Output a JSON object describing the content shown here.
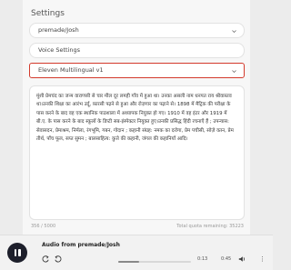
{
  "settings": {
    "title": "Settings"
  },
  "selects": {
    "voice": "premade/Josh",
    "voice_settings": "Voice Settings",
    "model": "Eleven Multilingual v1"
  },
  "editor": {
    "text": "मुंशी प्रेमचंद का जन्म वाराणसी से चार मील दूर लमही गाँव में हुआ था। उनका असली नाम धनपत राय श्रीवास्तव था।उनकी शिक्षा का आरंभ उर्दू, फ़ारसी पढ़ने से हुआ और रोज़गार का पढ़ाने से। 1898 में मैट्रिक की परीक्षा के पास करने के बाद वह एक स्थानिक पाठशाला में अध्यापक नियुक्त हो गए। 1910 में वह इंटर और 1919 में बी.ए. के पास करने के बाद स्कूलों के डिप्टी सब-इंस्पेक्टर नियुक्त हुए।उनकी प्रसिद्ध हिंदी रचनाएँ हैं ; उपन्यास: सेवासदन, प्रेमाश्रम, निर्मला, रंगभूमि, गबन, गोदान ; कहानी संग्रह: नमक का दरोगा, प्रेम पचीसी, सोज़े वतन, प्रेम तीर्थ, पाँच फूल, सप्त सुमन ; बालसाहित्य: कुत्ते की कहानी, जंगल की कहानियाँ आदि।",
    "char_count": "356 / 5000",
    "quota": "Total quota remaining: 35223"
  },
  "player": {
    "title": "Audio from premade/Josh",
    "current_time": "0:13",
    "total_time": "0:45",
    "progress": 0.29
  },
  "icons": {
    "pause": "pause-icon",
    "rewind": "rewind-icon",
    "forward": "forward-icon",
    "volume": "volume-icon",
    "more": "more-icon",
    "chevron": "chevron-down-icon"
  }
}
